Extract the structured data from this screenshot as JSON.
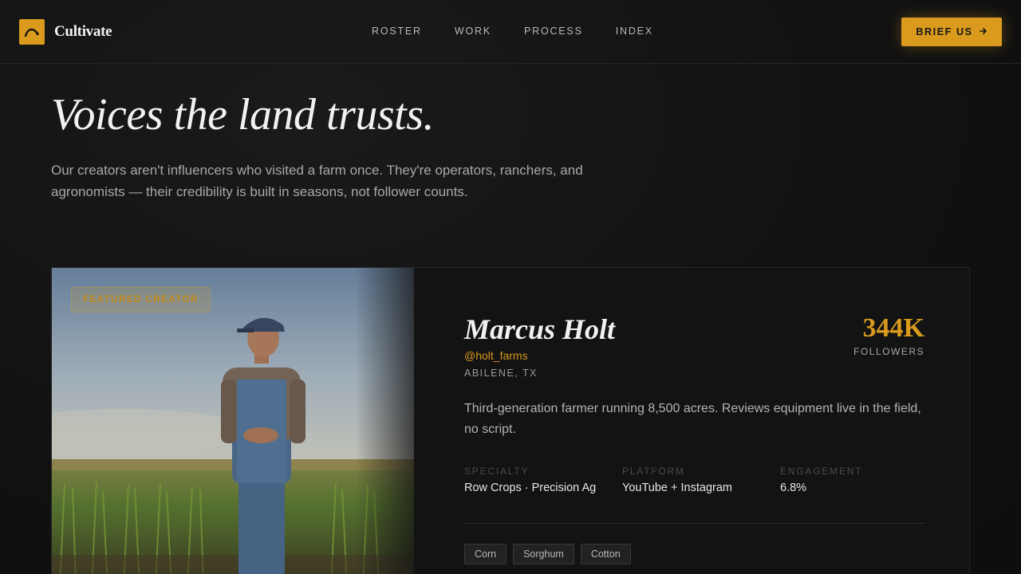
{
  "brand": {
    "name": "Cultivate",
    "accent": "#d99a1e"
  },
  "nav": {
    "links": [
      "ROSTER",
      "WORK",
      "PROCESS",
      "INDEX"
    ],
    "cta_label": "BRIEF US",
    "cta_icon": "arrow-right-icon"
  },
  "hero": {
    "title": "Voices the land trusts.",
    "subtitle": "Our creators aren't influencers who visited a farm once. They're operators, ranchers, and agronomists — their credibility is built in seasons, not follower counts."
  },
  "creator": {
    "badge": "FEATURED CREATOR",
    "name": "Marcus Holt",
    "handle": "@holt_farms",
    "location": "ABILENE, TX",
    "followers_value": "344K",
    "followers_label": "FOLLOWERS",
    "bio": "Third-generation farmer running 8,500 acres. Reviews equipment live in the field, no script.",
    "stats": [
      {
        "label": "SPECIALTY",
        "value": "Row Crops · Precision Ag"
      },
      {
        "label": "PLATFORM",
        "value": "YouTube + Instagram"
      },
      {
        "label": "ENGAGEMENT",
        "value": "6.8%"
      }
    ],
    "tags": [
      "Corn",
      "Sorghum",
      "Cotton"
    ]
  }
}
